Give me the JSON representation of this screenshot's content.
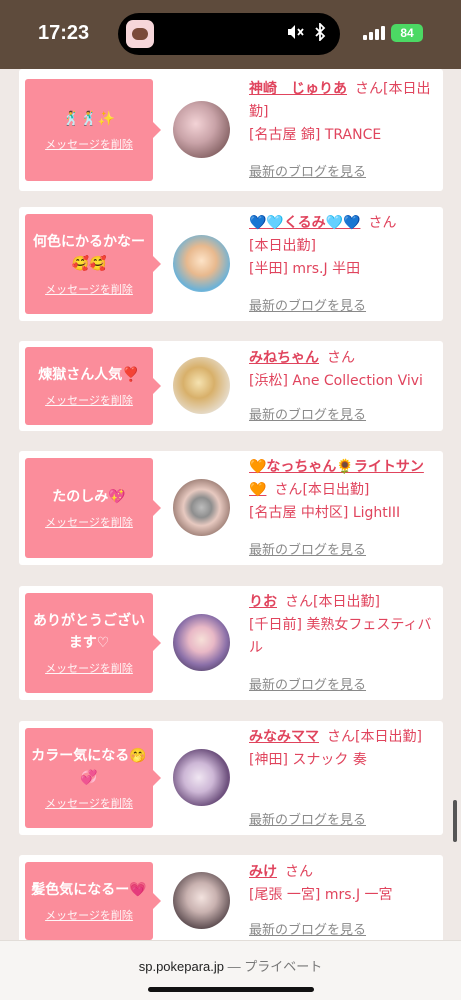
{
  "status_bar": {
    "time": "17:23",
    "battery": "84",
    "island_icons": [
      "mute-icon",
      "bluetooth-icon"
    ]
  },
  "colors": {
    "accent_pink": "#fb8d9b",
    "name_red": "#e0445d",
    "blog_gray": "#8a8a8a",
    "status_brown": "#5e4b3c"
  },
  "entries": [
    {
      "message": "🕺🕺✨",
      "delete_label": "メッセージを削除",
      "name": "神崎　じゅりあ",
      "san": "さん",
      "status": "[本日出勤]",
      "shop": "[名古屋 錦] TRANCE",
      "blog_label": "最新のブログを見る"
    },
    {
      "message": "何色にかるかなー🥰🥰",
      "delete_label": "メッセージを削除",
      "name": "💙🩵くるみ🩵💙",
      "san": "さん",
      "status": "[本日出勤]",
      "shop": "[半田] mrs.J 半田",
      "blog_label": "最新のブログを見る"
    },
    {
      "message": "煉獄さん人気❣️",
      "delete_label": "メッセージを削除",
      "name": "みねちゃん",
      "san": "さん",
      "status": "",
      "shop": "[浜松] Ane Collection Vivi",
      "blog_label": "最新のブログを見る"
    },
    {
      "message": "たのしみ💖",
      "delete_label": "メッセージを削除",
      "name": "🧡なっちゃん🌻ライトサン🧡",
      "san": "さん",
      "status": "[本日出勤]",
      "shop": "[名古屋 中村区] LightIII",
      "blog_label": "最新のブログを見る"
    },
    {
      "message": "ありがとうございます♡",
      "delete_label": "メッセージを削除",
      "name": "りお",
      "san": "さん",
      "status": "[本日出勤]",
      "shop": "[千日前] 美熟女フェスティバル",
      "blog_label": "最新のブログを見る"
    },
    {
      "message": "カラー気になる🤭💞",
      "delete_label": "メッセージを削除",
      "name": "みなみママ",
      "san": "さん",
      "status": "[本日出勤]",
      "shop": "[神田] スナック 奏",
      "blog_label": "最新のブログを見る"
    },
    {
      "message": "髪色気になるー💗",
      "delete_label": "メッセージを削除",
      "name": "みけ",
      "san": "さん",
      "status": "",
      "shop": "[尾張 一宮] mrs.J 一宮",
      "blog_label": "最新のブログを見る"
    }
  ],
  "url_bar": {
    "domain": "sp.pokepara.jp",
    "mode": "— プライベート"
  }
}
